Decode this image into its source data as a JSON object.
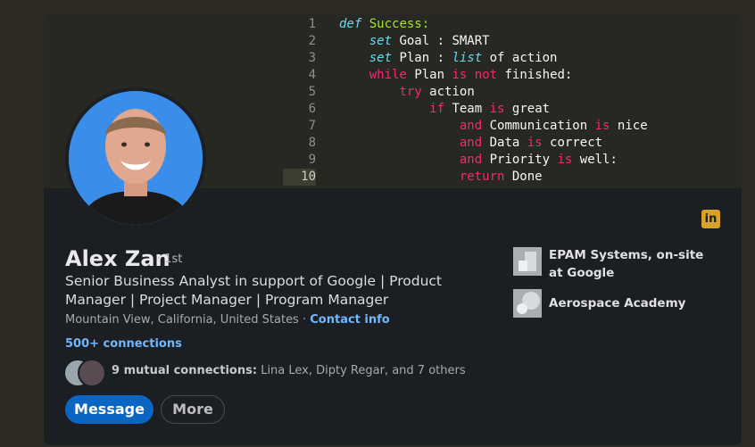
{
  "code": {
    "lines": [
      {
        "num": "1"
      },
      {
        "num": "2"
      },
      {
        "num": "3"
      },
      {
        "num": "4"
      },
      {
        "num": "5"
      },
      {
        "num": "6"
      },
      {
        "num": "7"
      },
      {
        "num": "8"
      },
      {
        "num": "9"
      },
      {
        "num": "10"
      }
    ],
    "tokens": {
      "def": "def",
      "success": "Success:",
      "set1": "set",
      "goal": "Goal : SMART",
      "set2": "set",
      "plan": "Plan :",
      "list": "list",
      "ofaction": "of action",
      "while": "while",
      "plan2": "Plan",
      "is1": "is",
      "not": "not",
      "finished": "finished:",
      "try": "try",
      "action": "action",
      "if": "if",
      "team": "Team",
      "is2": "is",
      "great": "great",
      "and1": "and",
      "comm": "Communication",
      "is3": "is",
      "nice": "nice",
      "and2": "and",
      "data": "Data",
      "is4": "is",
      "correct": "correct",
      "and3": "and",
      "priority": "Priority",
      "is5": "is",
      "well": "well:",
      "return": "return",
      "done": "Done"
    }
  },
  "profile": {
    "name": "Alex Zan",
    "degree": "· 1st",
    "headline": "Senior Business Analyst in support of Google | Product Manager | Project Manager | Program Manager",
    "location": "Mountain View, California, United States ·",
    "contact_info": "Contact info",
    "connections": "500+ connections",
    "mutual_bold": "9 mutual connections:",
    "mutual_names": "Lina Lex, Dipty Regar, and 7 others"
  },
  "actions": {
    "message": "Message",
    "more": "More"
  },
  "experience": [
    {
      "label": "EPAM Systems, on-site at Google"
    },
    {
      "label": "Aerospace Academy"
    }
  ],
  "icons": {
    "linkedin": "in"
  },
  "colors": {
    "accent": "#0a66c2",
    "link": "#71b7fb",
    "linkedin_badge": "#d7a22a"
  }
}
